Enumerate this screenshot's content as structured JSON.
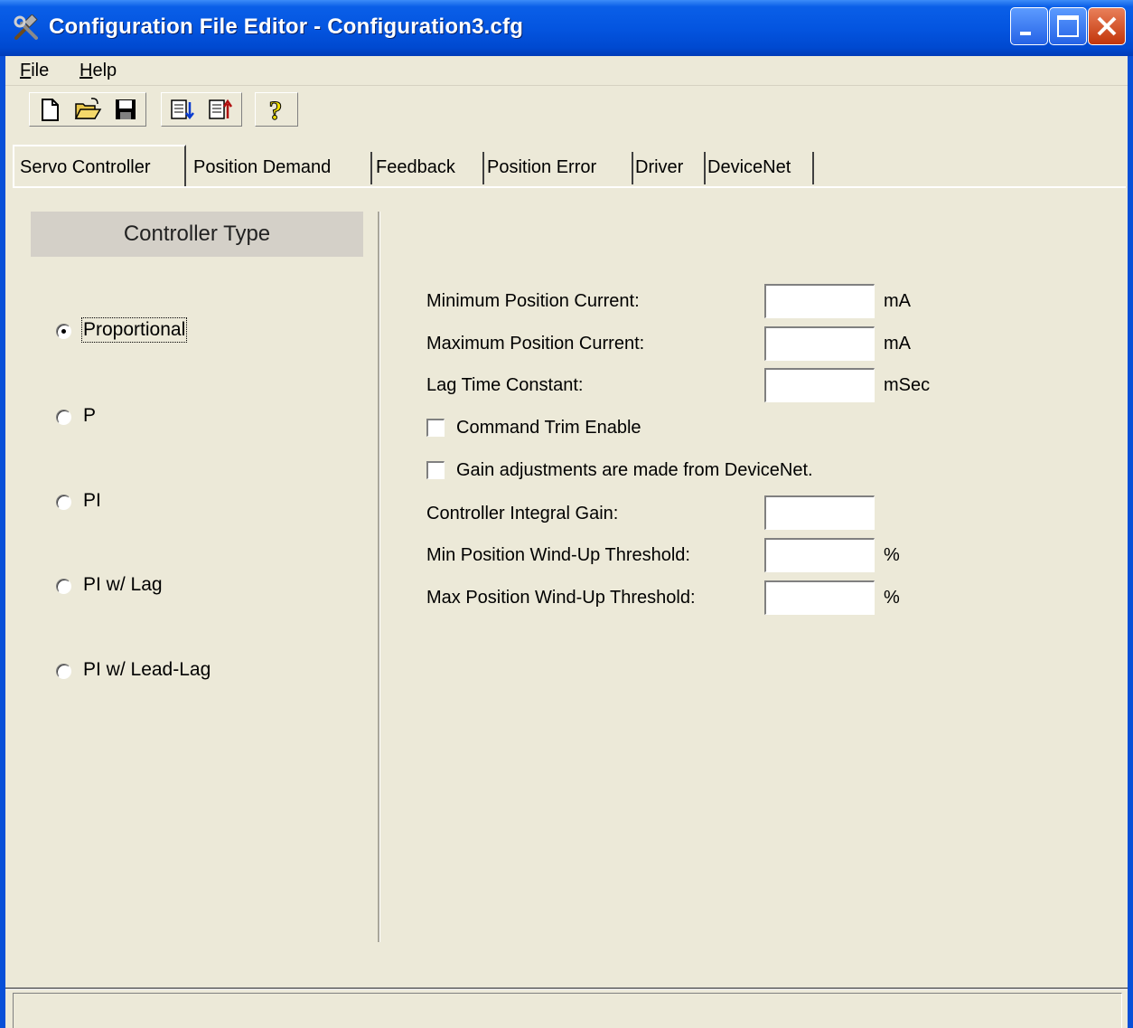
{
  "window": {
    "title": "Configuration File Editor - Configuration3.cfg",
    "controls": [
      "minimize-icon",
      "maximize-icon",
      "close-icon"
    ]
  },
  "menu": {
    "file": {
      "accel": "F",
      "rest": "ile"
    },
    "help": {
      "accel": "H",
      "rest": "elp"
    }
  },
  "toolbar": {
    "buttons": [
      "new-file-icon",
      "open-folder-icon",
      "save-disk-icon",
      "download-config-icon",
      "upload-config-icon",
      "help-icon"
    ],
    "help_glyph": "?"
  },
  "tabs": [
    "Servo Controller",
    "Position Demand",
    "Feedback",
    "Position Error",
    "Driver",
    "DeviceNet"
  ],
  "active_tab": "Servo Controller",
  "controller_type": {
    "header": "Controller Type",
    "options": [
      "Proportional",
      "P",
      "PI",
      "PI w/ Lag",
      "PI w/ Lead-Lag"
    ],
    "selected": "Proportional"
  },
  "fields": {
    "min_position_current": {
      "label": "Minimum Position Current:",
      "value": "",
      "unit": "mA"
    },
    "max_position_current": {
      "label": "Maximum Position Current:",
      "value": "",
      "unit": "mA"
    },
    "lag_time_constant": {
      "label": "Lag Time Constant:",
      "value": "",
      "unit": "mSec"
    },
    "command_trim_enable": {
      "label": "Command Trim Enable",
      "checked": false
    },
    "gain_from_devicenet": {
      "label": "Gain adjustments are made from DeviceNet.",
      "checked": false
    },
    "controller_integral_gain": {
      "label": "Controller Integral Gain:",
      "value": ""
    },
    "min_windup_threshold": {
      "label": "Min Position Wind-Up Threshold:",
      "value": "",
      "unit": "%"
    },
    "max_windup_threshold": {
      "label": "Max Position Wind-Up Threshold:",
      "value": "",
      "unit": "%"
    }
  },
  "status_text": ""
}
